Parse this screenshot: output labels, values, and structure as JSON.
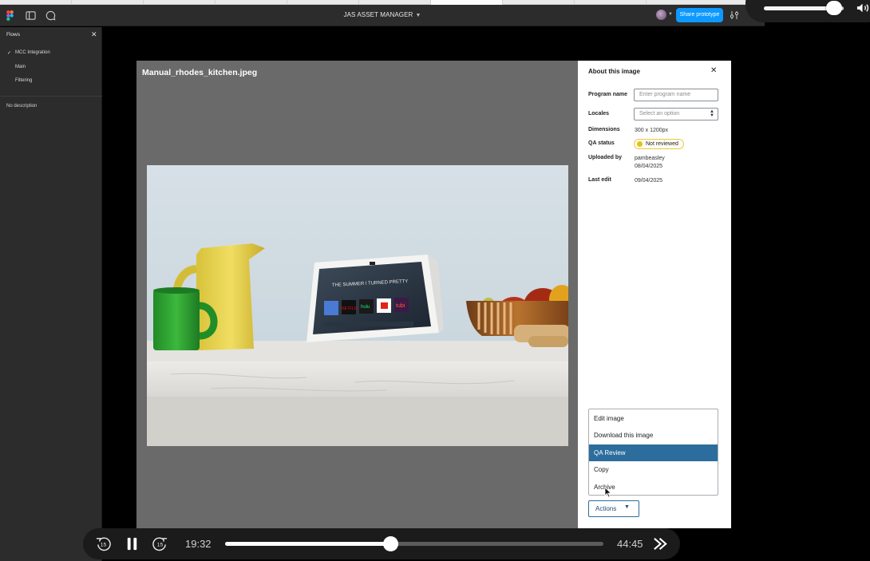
{
  "toolbar": {
    "file_title": "JAS ASSET MANAGER",
    "share_label": "Share prototype"
  },
  "left_panel": {
    "header": "Flows",
    "flows": [
      {
        "label": "MCC Integration",
        "selected": true
      },
      {
        "label": "Main",
        "selected": false
      },
      {
        "label": "Filtering",
        "selected": false
      }
    ],
    "description": "No description"
  },
  "preview": {
    "filename": "Manual_rhodes_kitchen.jpeg"
  },
  "side_panel": {
    "title": "About this image",
    "program_name_label": "Program name",
    "program_name_placeholder": "Enter program name",
    "locales_label": "Locales",
    "locales_placeholder": "Select an option",
    "dimensions_label": "Dimensions",
    "dimensions_value": "300 x 1200px",
    "qa_status_label": "QA status",
    "qa_status_value": "Not reviewed",
    "uploaded_by_label": "Uploaded by",
    "uploaded_by_user": "pambeasley",
    "uploaded_by_date": "08/04/2025",
    "last_edit_label": "Last edit",
    "last_edit_value": "09/04/2025",
    "actions_menu": [
      "Edit image",
      "Download this image",
      "QA Review",
      "Copy",
      "Archive"
    ],
    "actions_highlighted": "QA Review",
    "actions_label": "Actions"
  },
  "player": {
    "skip_back_seconds": "15",
    "skip_forward_seconds": "15",
    "elapsed": "19:32",
    "total": "44:45",
    "progress_fraction": 0.437
  },
  "volume": {
    "level_fraction": 0.88
  },
  "device_screen": {
    "headline": "THE SUMMER I TURNED PRETTY",
    "apps": [
      "NETFLIX",
      "hulu",
      "tubi"
    ]
  }
}
